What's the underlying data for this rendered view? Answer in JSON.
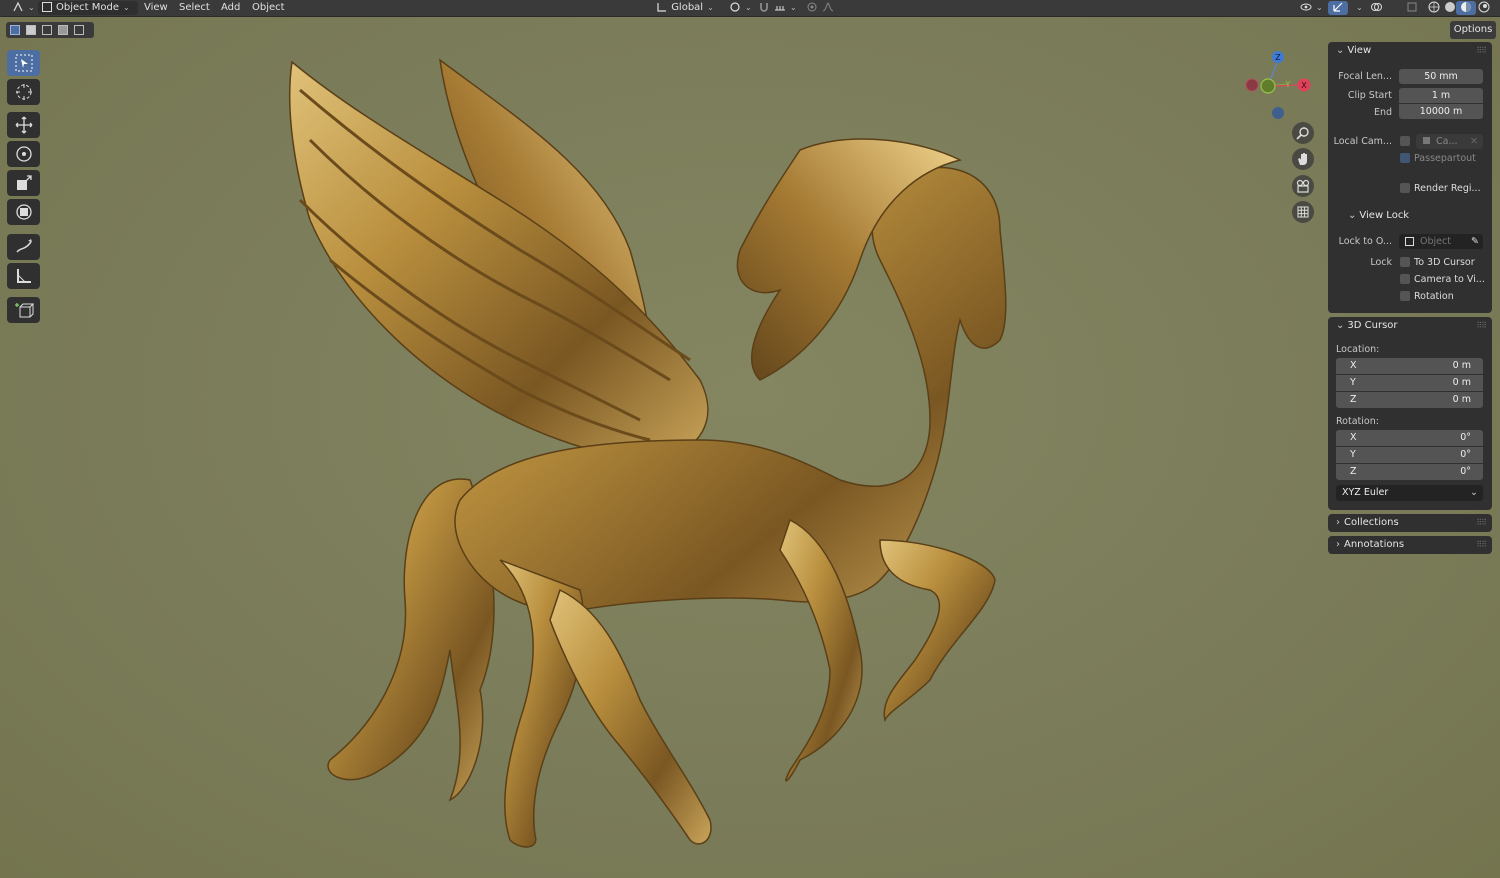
{
  "header": {
    "mode": "Object Mode",
    "menus": [
      "View",
      "Select",
      "Add",
      "Object"
    ],
    "orientation": "Global"
  },
  "options_label": "Options",
  "gizmo": {
    "z": "Z",
    "y": "Y",
    "x": "X"
  },
  "npanel": {
    "view": {
      "title": "View",
      "focal_label": "Focal Len...",
      "focal_value": "50 mm",
      "clip_start_label": "Clip Start",
      "clip_start_value": "1 m",
      "clip_end_label": "End",
      "clip_end_value": "10000 m",
      "local_cam_label": "Local Cam...",
      "local_cam_value": "Ca...",
      "passepartout": "Passepartout",
      "render_region": "Render Regi..."
    },
    "view_lock": {
      "title": "View Lock",
      "lock_to_label": "Lock to O...",
      "lock_to_placeholder": "Object",
      "lock_label": "Lock",
      "to_3d_cursor": "To 3D Cursor",
      "camera_to_view": "Camera to Vi...",
      "rotation": "Rotation"
    },
    "cursor": {
      "title": "3D Cursor",
      "location_label": "Location:",
      "loc": [
        {
          "axis": "X",
          "value": "0 m"
        },
        {
          "axis": "Y",
          "value": "0 m"
        },
        {
          "axis": "Z",
          "value": "0 m"
        }
      ],
      "rotation_label": "Rotation:",
      "rot": [
        {
          "axis": "X",
          "value": "0°"
        },
        {
          "axis": "Y",
          "value": "0°"
        },
        {
          "axis": "Z",
          "value": "0°"
        }
      ],
      "rotation_mode": "XYZ Euler"
    },
    "collections": "Collections",
    "annotations": "Annotations"
  },
  "colors": {
    "accent": "#4d6ea3",
    "viewport_bg": "#7b7c5b",
    "gold": "#b8913d"
  }
}
